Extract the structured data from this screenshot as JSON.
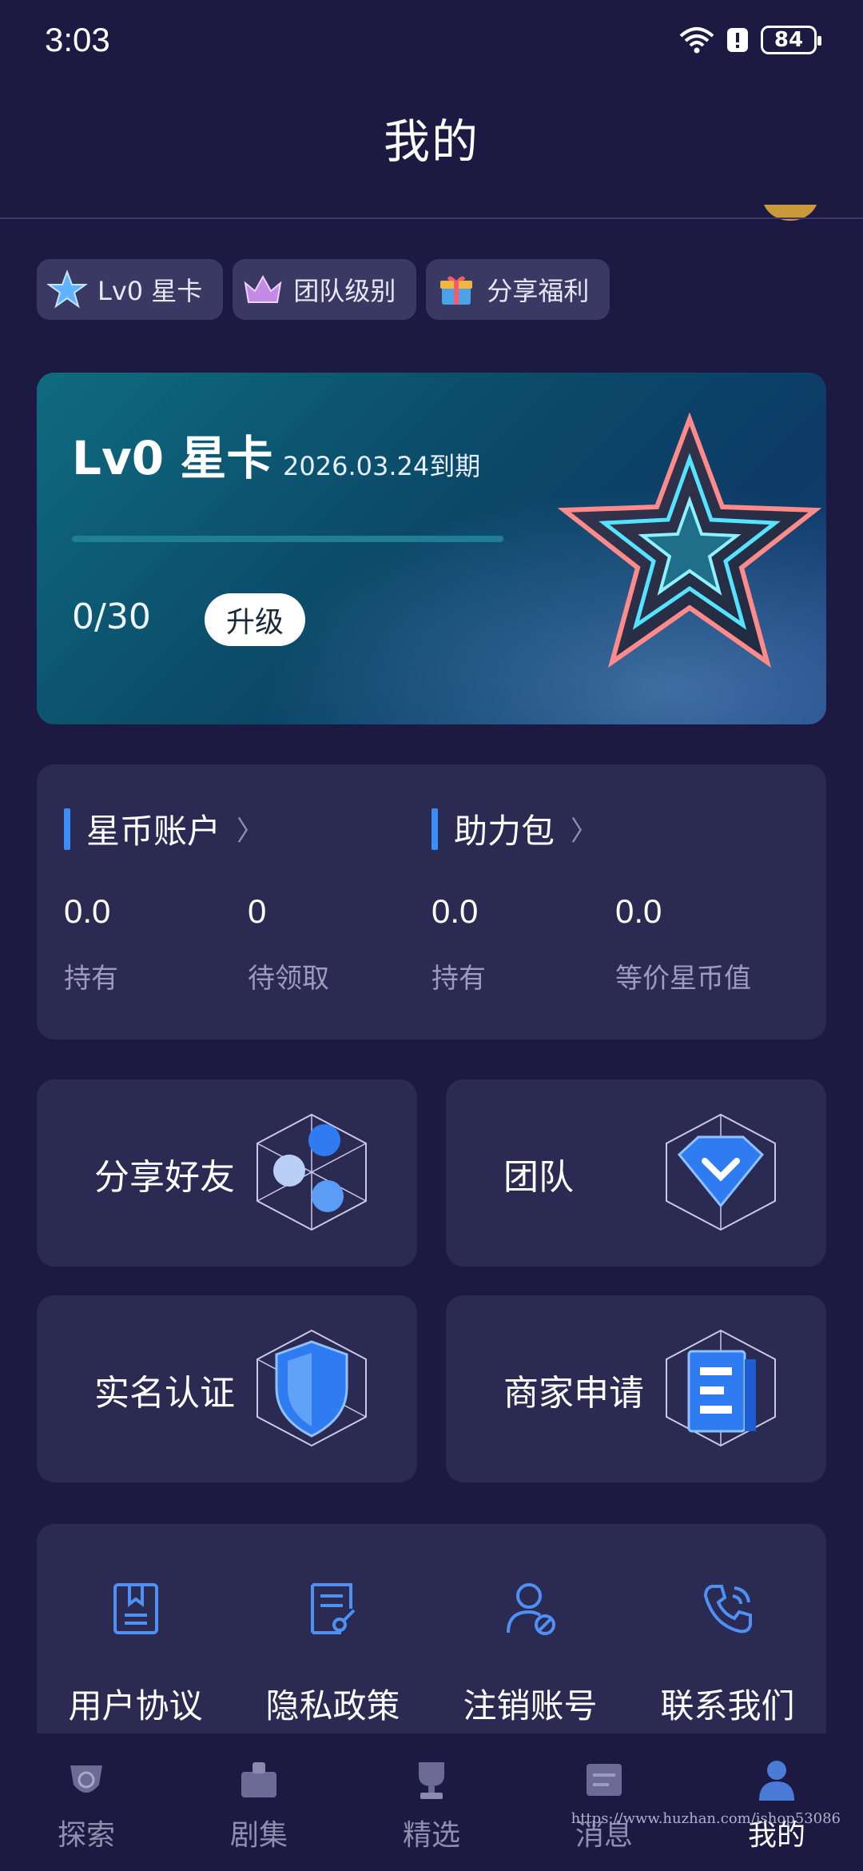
{
  "status_bar": {
    "time": "3:03",
    "battery": "84"
  },
  "header": {
    "title": "我的"
  },
  "chips": [
    {
      "label": "Lv0 星卡",
      "icon": "star-badge-icon"
    },
    {
      "label": "团队级别",
      "icon": "crown-icon"
    },
    {
      "label": "分享福利",
      "icon": "gift-icon"
    }
  ],
  "star_card": {
    "title": "Lv0 星卡",
    "expiry": "2026.03.24到期",
    "count": "0/30",
    "progress": 0,
    "upgrade_label": "升级"
  },
  "wallet": {
    "coin_title": "星币账户",
    "boost_title": "助力包",
    "items": [
      {
        "value": "0.0",
        "label": "持有"
      },
      {
        "value": "0",
        "label": "待领取"
      },
      {
        "value": "0.0",
        "label": "持有"
      },
      {
        "value": "0.0",
        "label": "等价星币值"
      }
    ]
  },
  "features": [
    {
      "label": "分享好友",
      "icon": "share-cube-icon"
    },
    {
      "label": "团队",
      "icon": "team-diamond-icon"
    },
    {
      "label": "实名认证",
      "icon": "shield-cube-icon"
    },
    {
      "label": "商家申请",
      "icon": "merchant-cube-icon"
    }
  ],
  "links": [
    {
      "label": "用户协议",
      "icon": "book-icon"
    },
    {
      "label": "隐私政策",
      "icon": "document-pen-icon"
    },
    {
      "label": "注销账号",
      "icon": "user-cancel-icon"
    },
    {
      "label": "联系我们",
      "icon": "phone-icon"
    }
  ],
  "nav": [
    {
      "label": "探索",
      "icon": "explore-icon"
    },
    {
      "label": "剧集",
      "icon": "episodes-icon"
    },
    {
      "label": "精选",
      "icon": "trophy-icon"
    },
    {
      "label": "消息",
      "icon": "message-icon"
    },
    {
      "label": "我的",
      "icon": "profile-icon",
      "active": true
    }
  ],
  "watermark": "https://www.huzhan.com/ishop53086",
  "colors": {
    "background": "#1c1a43",
    "panel": "#2b2a52",
    "accent": "#3b8df7"
  }
}
